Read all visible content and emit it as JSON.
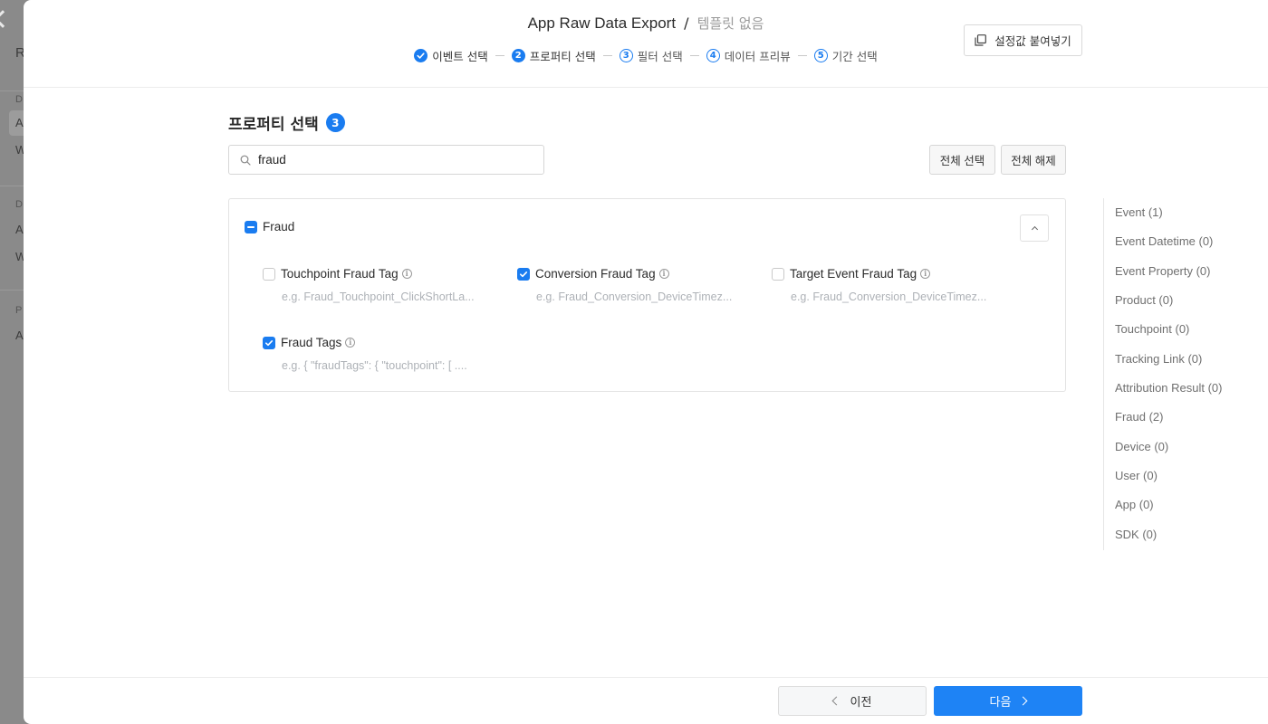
{
  "backdrop": {
    "letter_top": "R",
    "items": [
      "D",
      "A",
      "W",
      "D",
      "A",
      "W",
      "P",
      "A"
    ]
  },
  "header": {
    "title": "App Raw Data Export",
    "separator": "/",
    "subtitle": "템플릿 없음",
    "paste_button": "설정값 붙여넣기"
  },
  "steps": [
    {
      "label": "이벤트 선택",
      "num": "",
      "state": "done"
    },
    {
      "label": "프로퍼티 선택",
      "num": "2",
      "state": "current"
    },
    {
      "label": "필터 선택",
      "num": "3",
      "state": "upcoming"
    },
    {
      "label": "데이터 프리뷰",
      "num": "4",
      "state": "upcoming"
    },
    {
      "label": "기간 선택",
      "num": "5",
      "state": "upcoming"
    }
  ],
  "section": {
    "title": "프로퍼티 선택",
    "count": "3"
  },
  "search": {
    "value": "fraud",
    "placeholder": ""
  },
  "actions": {
    "select_all": "전체 선택",
    "deselect_all": "전체 해제"
  },
  "group": {
    "label": "Fraud",
    "state": "indeterminate",
    "properties": [
      {
        "label": "Touchpoint Fraud Tag",
        "example": "e.g. Fraud_Touchpoint_ClickShortLa...",
        "checked": false
      },
      {
        "label": "Conversion Fraud Tag",
        "example": "e.g. Fraud_Conversion_DeviceTimez...",
        "checked": true
      },
      {
        "label": "Target Event Fraud Tag",
        "example": "e.g. Fraud_Conversion_DeviceTimez...",
        "checked": false
      },
      {
        "label": "Fraud Tags",
        "example": "e.g. { \"fraudTags\": { \"touchpoint\": [ ....",
        "checked": true
      }
    ]
  },
  "categories": [
    "Event (1)",
    "Event Datetime (0)",
    "Event Property (0)",
    "Product (0)",
    "Touchpoint (0)",
    "Tracking Link (0)",
    "Attribution Result (0)",
    "Fraud (2)",
    "Device (0)",
    "User (0)",
    "App (0)",
    "SDK (0)"
  ],
  "footer": {
    "prev_label": "이전",
    "next_label": "다음"
  },
  "colors": {
    "accent": "#1a7cf0",
    "primary_button": "#1e83f5"
  }
}
